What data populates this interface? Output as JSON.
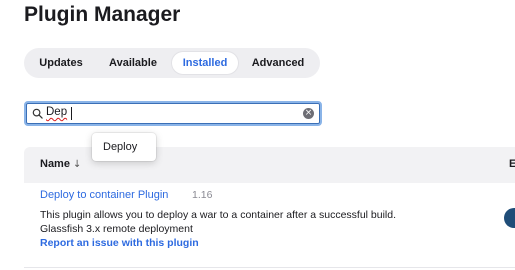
{
  "page": {
    "title": "Plugin Manager"
  },
  "tabs": [
    {
      "label": "Updates",
      "active": false
    },
    {
      "label": "Available",
      "active": false
    },
    {
      "label": "Installed",
      "active": true
    },
    {
      "label": "Advanced",
      "active": false
    }
  ],
  "search": {
    "value": "Dep",
    "icon": "search-icon",
    "clear_icon": "clear-icon"
  },
  "autocomplete": {
    "items": [
      "Deploy"
    ]
  },
  "table": {
    "columns": {
      "name": "Name",
      "sort_indicator": "↓",
      "enabled": "Er"
    },
    "rows": [
      {
        "name": "Deploy to container Plugin",
        "version": "1.16",
        "description": "This plugin allows you to deploy a war to a container after a successful build.",
        "dependency": "Glassfish 3.x remote deployment",
        "report_link": "Report an issue with this plugin",
        "enabled": true
      }
    ]
  },
  "colors": {
    "accent": "#2d6ae0",
    "toggle_on": "#1f4d78",
    "tabbar_bg": "#eeeef1",
    "header_bg": "#f2f2f4"
  }
}
